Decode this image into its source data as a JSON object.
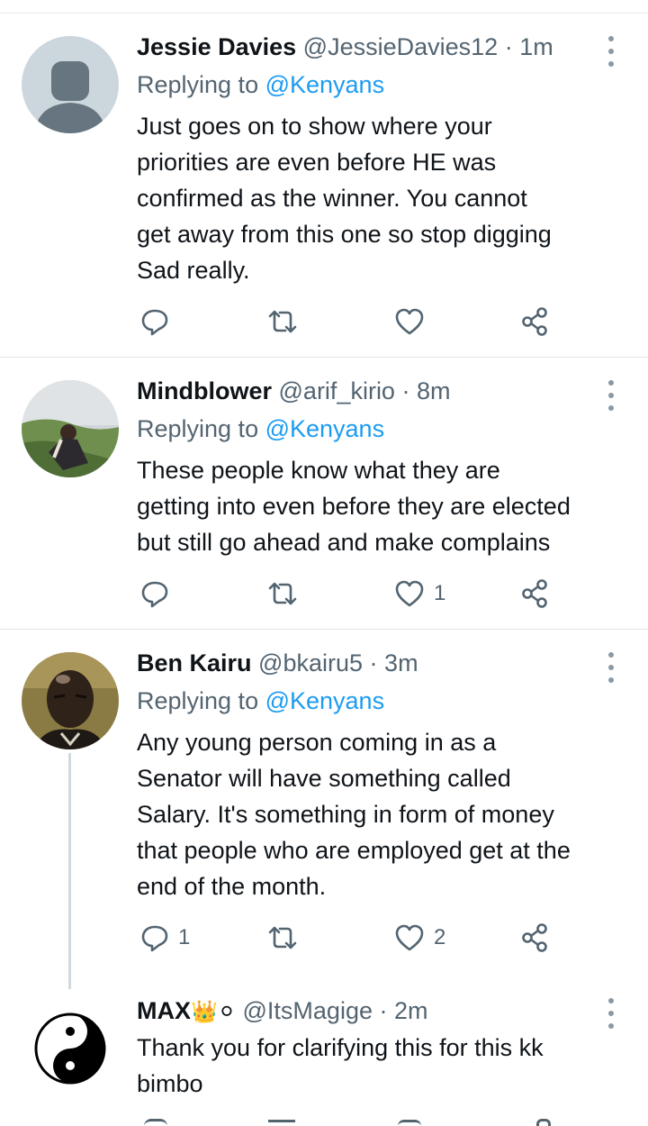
{
  "tweets": [
    {
      "name": "Jessie Davies",
      "handle": "@JessieDavies12",
      "dot": "·",
      "time": "1m",
      "replying_prefix": "Replying to ",
      "replying_to": "@Kenyans",
      "text": "Just goes on to show where your\npriorities are even before HE was\nconfirmed as the winner.  You cannot\nget away from this one so stop digging\nSad really.",
      "reply_count": "",
      "like_count": "",
      "avatar": "default-person-avatar"
    },
    {
      "name": "Mindblower",
      "handle": "@arif_kirio",
      "dot": "·",
      "time": "8m",
      "replying_prefix": "Replying to ",
      "replying_to": "@Kenyans",
      "text": "These people know what they are\ngetting into even before they are elected\nbut still go ahead and make complains",
      "reply_count": "",
      "like_count": "1",
      "avatar": "photo-person-outdoors"
    },
    {
      "name": "Ben Kairu",
      "handle": "@bkairu5",
      "dot": "·",
      "time": "3m",
      "replying_prefix": "Replying to ",
      "replying_to": "@Kenyans",
      "text": "Any young person coming in as a\nSenator will have something called\nSalary. It's something in form of money\nthat people who are employed get at the\nend of the month.",
      "reply_count": "1",
      "like_count": "2",
      "avatar": "photo-man-portrait"
    },
    {
      "name": "MAX",
      "name_emoji": "👑⚪",
      "handle": "@ItsMagige",
      "dot": "·",
      "time": "2m",
      "text": "Thank you for clarifying this for this kk\nbimbo",
      "avatar": "yin-yang"
    }
  ],
  "colors": {
    "text": "#0f1419",
    "secondary": "#536471",
    "link": "#1d9bf0",
    "divider": "#e1e6ea",
    "icon": "#536471"
  },
  "icons": [
    "reply-icon",
    "retweet-icon",
    "like-icon",
    "share-icon",
    "more-icon"
  ]
}
